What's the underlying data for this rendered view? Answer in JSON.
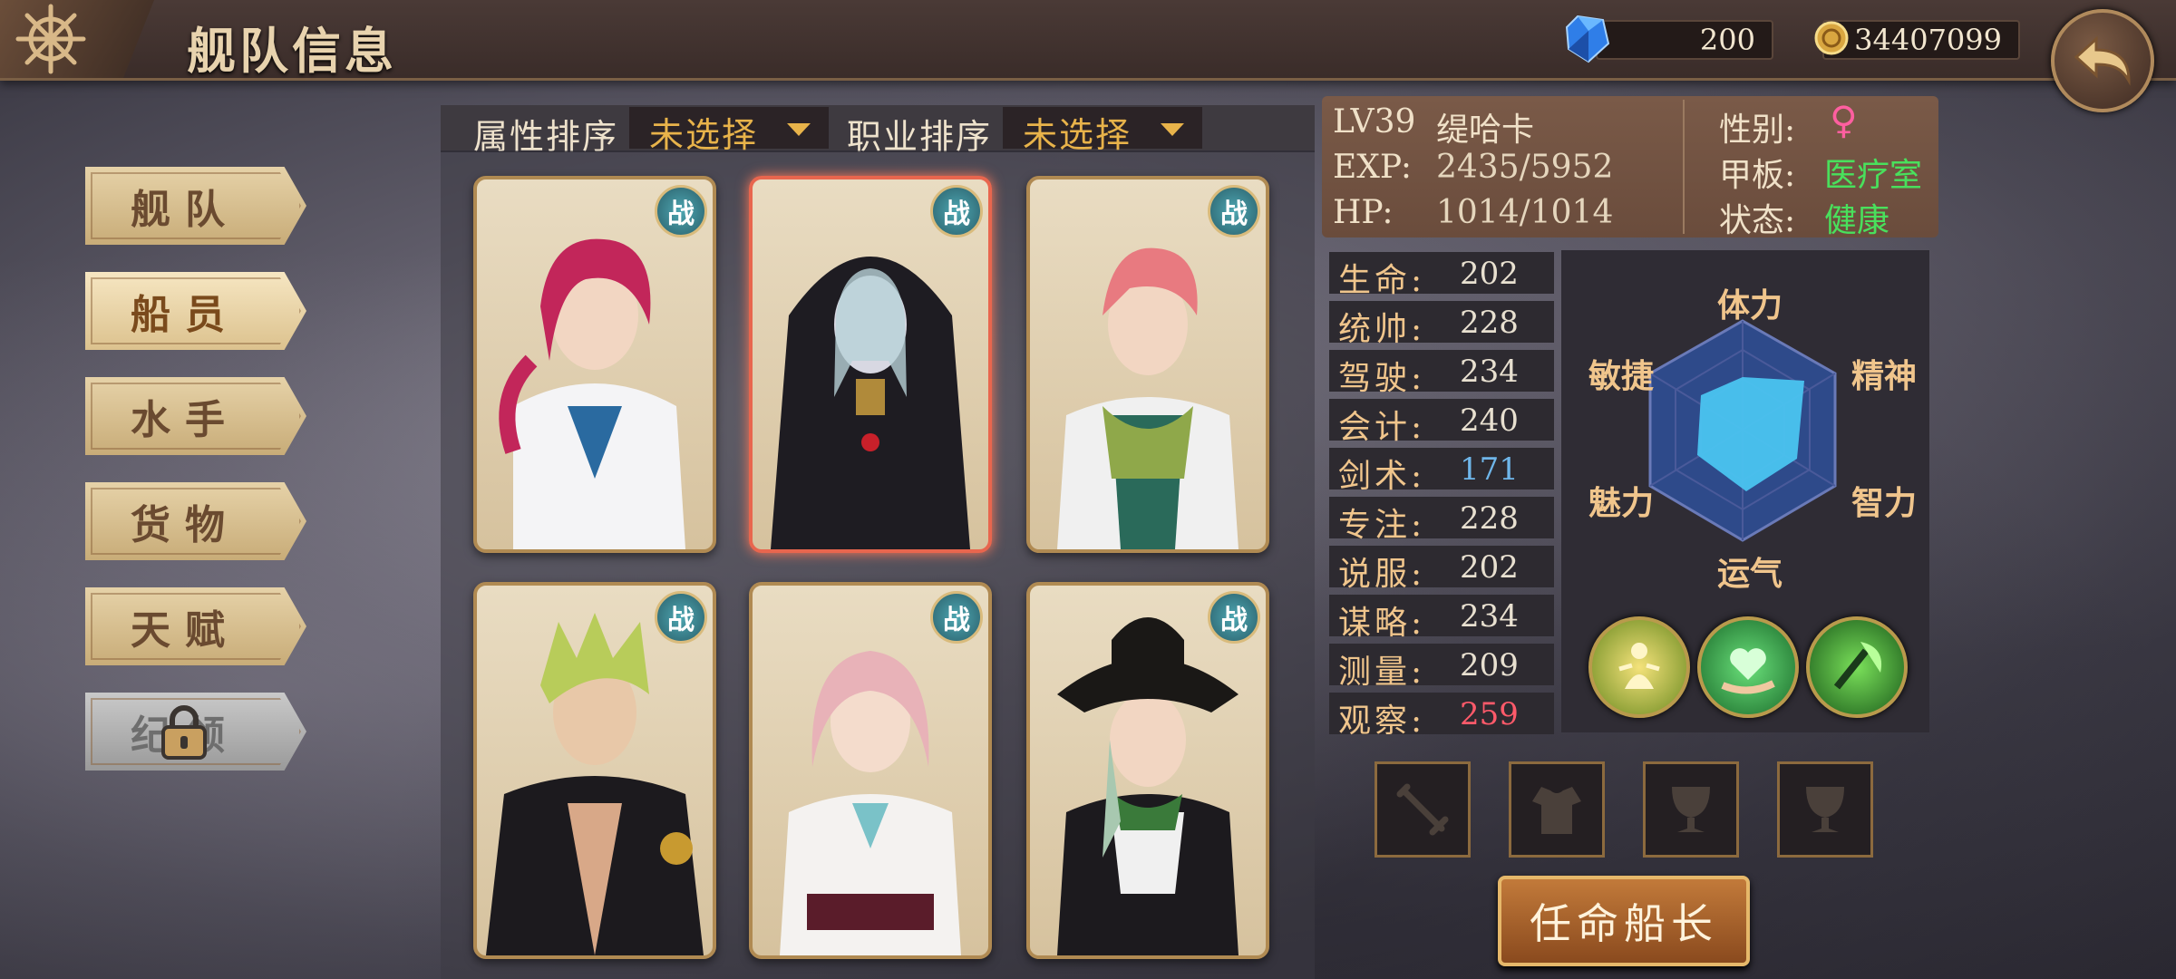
{
  "header": {
    "title": "舰队信息",
    "gems": "200",
    "coins": "34407099"
  },
  "menu": [
    {
      "label": "舰队",
      "state": "normal"
    },
    {
      "label": "船员",
      "state": "active"
    },
    {
      "label": "水手",
      "state": "normal"
    },
    {
      "label": "货物",
      "state": "normal"
    },
    {
      "label": "天赋",
      "state": "normal"
    },
    {
      "label": "纪领",
      "state": "locked"
    }
  ],
  "filters": {
    "attr_label": "属性排序",
    "attr_value": "未选择",
    "job_label": "职业排序",
    "job_value": "未选择"
  },
  "cards": [
    {
      "badge": "战",
      "selected": false
    },
    {
      "badge": "战",
      "selected": true
    },
    {
      "badge": "战",
      "selected": false
    },
    {
      "badge": "战",
      "selected": false
    },
    {
      "badge": "战",
      "selected": false
    },
    {
      "badge": "战",
      "selected": false
    }
  ],
  "crew": {
    "level": "LV39",
    "name": "缇哈卡",
    "exp_label": "EXP:",
    "exp": "2435/5952",
    "hp_label": "HP:",
    "hp": "1014/1014",
    "gender_label": "性别:",
    "gender": "♀",
    "deck_label": "甲板:",
    "deck": "医疗室",
    "status_label": "状态:",
    "status": "健康"
  },
  "stats": [
    {
      "label": "生命:",
      "value": "202",
      "color": "#e8e0d0"
    },
    {
      "label": "统帅:",
      "value": "228",
      "color": "#e8e0d0"
    },
    {
      "label": "驾驶:",
      "value": "234",
      "color": "#e8e0d0"
    },
    {
      "label": "会计:",
      "value": "240",
      "color": "#e8e0d0"
    },
    {
      "label": "剑术:",
      "value": "171",
      "color": "#6fb6ea"
    },
    {
      "label": "专注:",
      "value": "228",
      "color": "#e8e0d0"
    },
    {
      "label": "说服:",
      "value": "202",
      "color": "#e8e0d0"
    },
    {
      "label": "谋略:",
      "value": "234",
      "color": "#e8e0d0"
    },
    {
      "label": "测量:",
      "value": "209",
      "color": "#e8e0d0"
    },
    {
      "label": "观察:",
      "value": "259",
      "color": "#ff5a6a"
    }
  ],
  "radar": {
    "labels": {
      "top": "体力",
      "right_top": "精神",
      "right_bottom": "智力",
      "bottom": "运气",
      "left_bottom": "魅力",
      "left_top": "敏捷"
    }
  },
  "action": {
    "appoint": "任命船长"
  }
}
